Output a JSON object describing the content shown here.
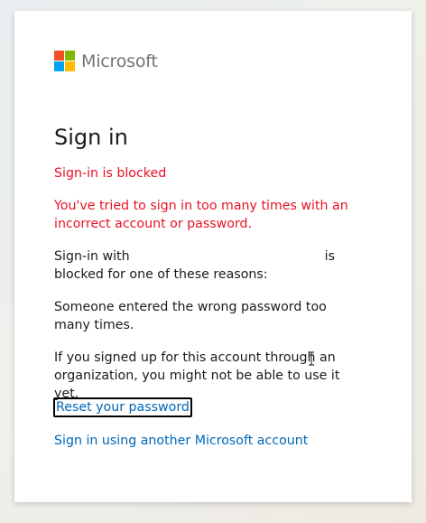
{
  "brand": {
    "name": "Microsoft",
    "logo_icon": "microsoft-logo-icon",
    "colors": [
      "#f25022",
      "#7fba00",
      "#00a4ef",
      "#ffb900"
    ]
  },
  "signin": {
    "title": "Sign in",
    "error_heading": "Sign-in is blocked",
    "error_message": "You've tried to sign in too many times with an incorrect account or password.",
    "blocked_prefix": "Sign-in with",
    "blocked_suffix_is": "is",
    "blocked_suffix_rest": "blocked for one of these reasons:",
    "reason_1": "Someone entered the wrong password too many times.",
    "reason_2": "If you signed up for this account through an organization, you might not be able to use it yet.",
    "reset_link": "Reset your password",
    "other_account_link": "Sign in using another Microsoft account"
  },
  "colors": {
    "error": "#e81123",
    "link": "#0067b8",
    "text": "#1b1b1b"
  },
  "cursor_icon": "text-cursor-icon"
}
